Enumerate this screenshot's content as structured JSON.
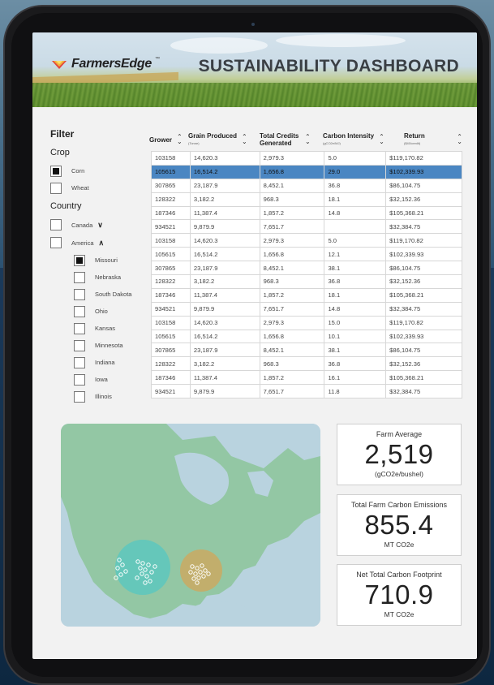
{
  "app": {
    "brand": "FarmersEdge",
    "trademark": "™",
    "title": "SUSTAINABILITY DASHBOARD"
  },
  "filter": {
    "heading": "Filter",
    "crop_label": "Crop",
    "crops": [
      {
        "label": "Corn",
        "checked": true
      },
      {
        "label": "Wheat",
        "checked": false
      }
    ],
    "country_label": "Country",
    "countries": [
      {
        "label": "Canada",
        "checked": false,
        "chevron": "chevron-down"
      },
      {
        "label": "America",
        "checked": false,
        "chevron": "chevron-up"
      }
    ],
    "states": [
      {
        "label": "Missouri",
        "checked": true
      },
      {
        "label": "Nebraska",
        "checked": false
      },
      {
        "label": "South Dakota",
        "checked": false
      },
      {
        "label": "Ohio",
        "checked": false
      },
      {
        "label": "Kansas",
        "checked": false
      },
      {
        "label": "Minnesota",
        "checked": false
      },
      {
        "label": "Indiana",
        "checked": false
      },
      {
        "label": "Iowa",
        "checked": false
      },
      {
        "label": "Illinois",
        "checked": false
      }
    ]
  },
  "table": {
    "columns": [
      {
        "label": "Grower",
        "sub": ""
      },
      {
        "label": "Grain Produced",
        "sub": "(Tonne)"
      },
      {
        "label": "Total Credits Generated",
        "sub": ""
      },
      {
        "label": "Carbon Intensity",
        "sub": "(gCO2e/MJ)"
      },
      {
        "label": "Return",
        "sub": "($40/credit)"
      }
    ],
    "selected_row": 1,
    "rows": [
      [
        "103158",
        "14,620.3",
        "2,979.3",
        "5.0",
        "$119,170.82"
      ],
      [
        "105615",
        "16,514.2",
        "1,656.8",
        "29.0",
        "$102,339.93"
      ],
      [
        "307865",
        "23,187.9",
        "8,452.1",
        "36.8",
        "$86,104.75"
      ],
      [
        "128322",
        "3,182.2",
        "968.3",
        "18.1",
        "$32,152.36"
      ],
      [
        "187346",
        "11,387.4",
        "1,857.2",
        "14.8",
        "$105,368.21"
      ],
      [
        "934521",
        "9,879.9",
        "7,651.7",
        "",
        "$32,384.75"
      ],
      [
        "103158",
        "14,620.3",
        "2,979.3",
        "5.0",
        "$119,170.82"
      ],
      [
        "105615",
        "16,514.2",
        "1,656.8",
        "12.1",
        "$102,339.93"
      ],
      [
        "307865",
        "23,187.9",
        "8,452.1",
        "38.1",
        "$86,104.75"
      ],
      [
        "128322",
        "3,182.2",
        "968.3",
        "36.8",
        "$32,152.36"
      ],
      [
        "187346",
        "11,387.4",
        "1,857.2",
        "18.1",
        "$105,368.21"
      ],
      [
        "934521",
        "9,879.9",
        "7,651.7",
        "14.8",
        "$32,384.75"
      ],
      [
        "103158",
        "14,620.3",
        "2,979.3",
        "15.0",
        "$119,170.82"
      ],
      [
        "105615",
        "16,514.2",
        "1,656.8",
        "10.1",
        "$102,339.93"
      ],
      [
        "307865",
        "23,187.9",
        "8,452.1",
        "38.1",
        "$86,104.75"
      ],
      [
        "128322",
        "3,182.2",
        "968.3",
        "36.8",
        "$32,152.36"
      ],
      [
        "187346",
        "11,387.4",
        "1,857.2",
        "16.1",
        "$105,368.21"
      ],
      [
        "934521",
        "9,879.9",
        "7,651.7",
        "11.8",
        "$32,384.75"
      ]
    ]
  },
  "stats": [
    {
      "title": "Farm Average",
      "value": "2,519",
      "unit": "(gCO2e/bushel)"
    },
    {
      "title": "Total Farm Carbon Emissions",
      "value": "855.4",
      "unit": "MT CO2e"
    },
    {
      "title": "Net Total Carbon Footprint",
      "value": "710.9",
      "unit": "MT CO2e"
    }
  ],
  "colors": {
    "selected_row": "#4a86c2",
    "map_water": "#b9d3df",
    "map_land": "#93c7a4",
    "cluster_west": "#56c7c2",
    "cluster_central": "#d2a65a"
  }
}
